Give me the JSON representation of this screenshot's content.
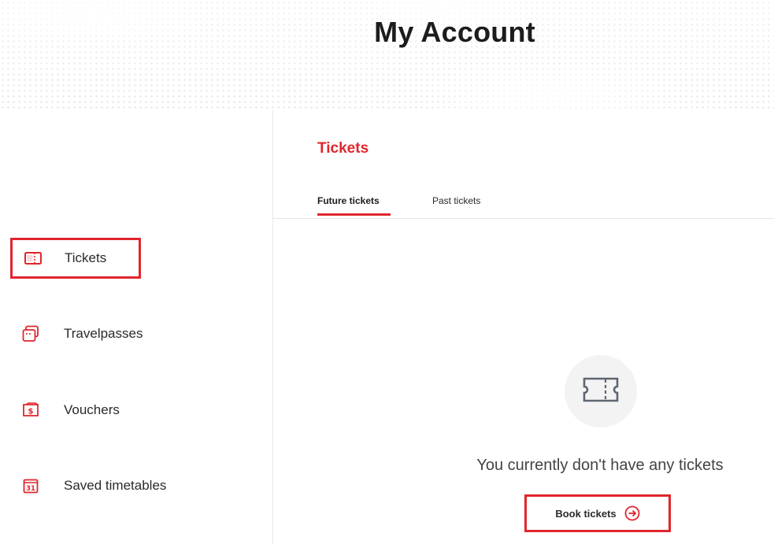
{
  "header": {
    "title": "My Account"
  },
  "sidebar": {
    "items": [
      {
        "label": "Tickets",
        "icon": "ticket-icon",
        "active": true
      },
      {
        "label": "Travelpasses",
        "icon": "travelpass-icon",
        "active": false
      },
      {
        "label": "Vouchers",
        "icon": "voucher-icon",
        "active": false
      },
      {
        "label": "Saved timetables",
        "icon": "calendar-icon",
        "active": false
      }
    ]
  },
  "main": {
    "title": "Tickets",
    "tabs": [
      {
        "label": "Future tickets",
        "active": true
      },
      {
        "label": "Past tickets",
        "active": false
      }
    ],
    "empty_state": {
      "icon": "ticket-icon",
      "message": "You currently don't have any tickets"
    },
    "book_button": {
      "label": "Book tickets",
      "icon": "arrow-circle-right-icon"
    }
  },
  "colors": {
    "accent": "#e0262d",
    "text": "#2a2a2a",
    "divider": "#e6e6e6"
  }
}
